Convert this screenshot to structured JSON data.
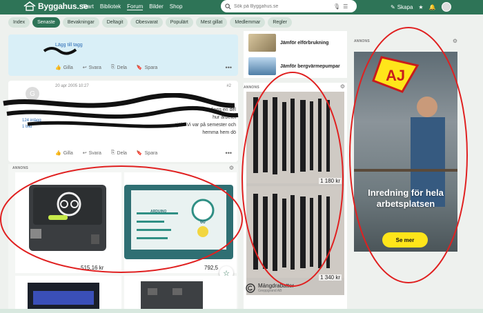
{
  "topbar": {
    "site_name": "Byggahus.se",
    "nav": [
      "Start",
      "Bibliotek",
      "Forum",
      "Bilder",
      "Shop"
    ],
    "active_nav": "Forum",
    "search_placeholder": "Sök på Byggahus.se",
    "create_label": "Skapa"
  },
  "subnav": {
    "items": [
      "Index",
      "Senaste",
      "Bevakningar",
      "Deltagit",
      "Obesvarat",
      "Populärt",
      "Mest gillat",
      "Medlemmar",
      "Regler"
    ],
    "active": "Senaste"
  },
  "post1": {
    "tag_link": "Lägg till tagg",
    "actions": [
      "Gilla",
      "Svara",
      "Dela",
      "Spara"
    ]
  },
  "post2": {
    "avatar_letter": "G",
    "date": "20 apr 2005 10:27",
    "post_number": "#2",
    "body_fragments": [
      "Det finns en del",
      "hur arbetet",
      "själv. Vi var på semester och",
      "hemma hem dö"
    ],
    "side_info": [
      "124 inlägg",
      "1 bild"
    ],
    "actions": [
      "Gilla",
      "Svara",
      "Dela",
      "Spara"
    ]
  },
  "ad_left": {
    "label": "ANNONS",
    "product1_price": "515,16 kr",
    "product2_price": "792,5",
    "product2_screen_brand": "ARDUINO",
    "product2_screen_value": "60"
  },
  "mid_col": {
    "items": [
      {
        "label": "Jämför elförbrukning"
      },
      {
        "label": "Jämför bergvärmepumpar"
      }
    ],
    "ad_label": "ANNONS",
    "prices": [
      "1 180 kr",
      "1 340 kr"
    ],
    "brand_name": "Mängdrabatter",
    "brand_sub": "Greppgrand AB"
  },
  "right_ad": {
    "label": "ANNONS",
    "logo_text": "AJ",
    "headline": "Inredning för hela arbetsplatsen",
    "cta": "Se mer"
  },
  "colors": {
    "brand_green": "#2e7457",
    "annotation_red": "#e02020"
  }
}
